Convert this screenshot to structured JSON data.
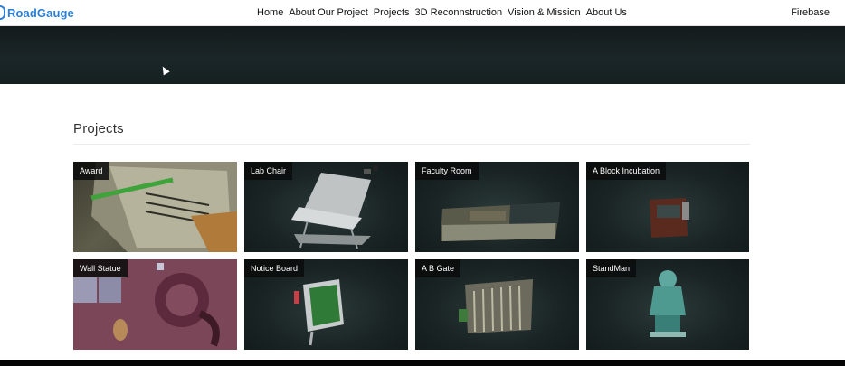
{
  "navbar": {
    "brand": "RoadGauge",
    "links": [
      "Home",
      "About Our Project",
      "Projects",
      "3D Reconnstruction",
      "Vision & Mission",
      "About Us"
    ],
    "right_link": "Firebase"
  },
  "projects": {
    "title": "Projects",
    "cards": [
      {
        "label": "Award",
        "thumb": "award-scan-image"
      },
      {
        "label": "Lab Chair",
        "thumb": "lab-chair-scan-image"
      },
      {
        "label": "Faculty Room",
        "thumb": "faculty-room-scan-image"
      },
      {
        "label": "A Block Incubation",
        "thumb": "a-block-incubation-scan-image"
      },
      {
        "label": "Wall Statue",
        "thumb": "wall-statue-scan-image"
      },
      {
        "label": "Notice Board",
        "thumb": "notice-board-scan-image"
      },
      {
        "label": "A B Gate",
        "thumb": "a-b-gate-scan-image"
      },
      {
        "label": "StandMan",
        "thumb": "standman-scan-image"
      }
    ]
  },
  "colors": {
    "brand": "#2b7fd6",
    "hero_bg": "#1b2628",
    "card_bg": "#1a2424",
    "label_bg": "#0a0c0c"
  }
}
